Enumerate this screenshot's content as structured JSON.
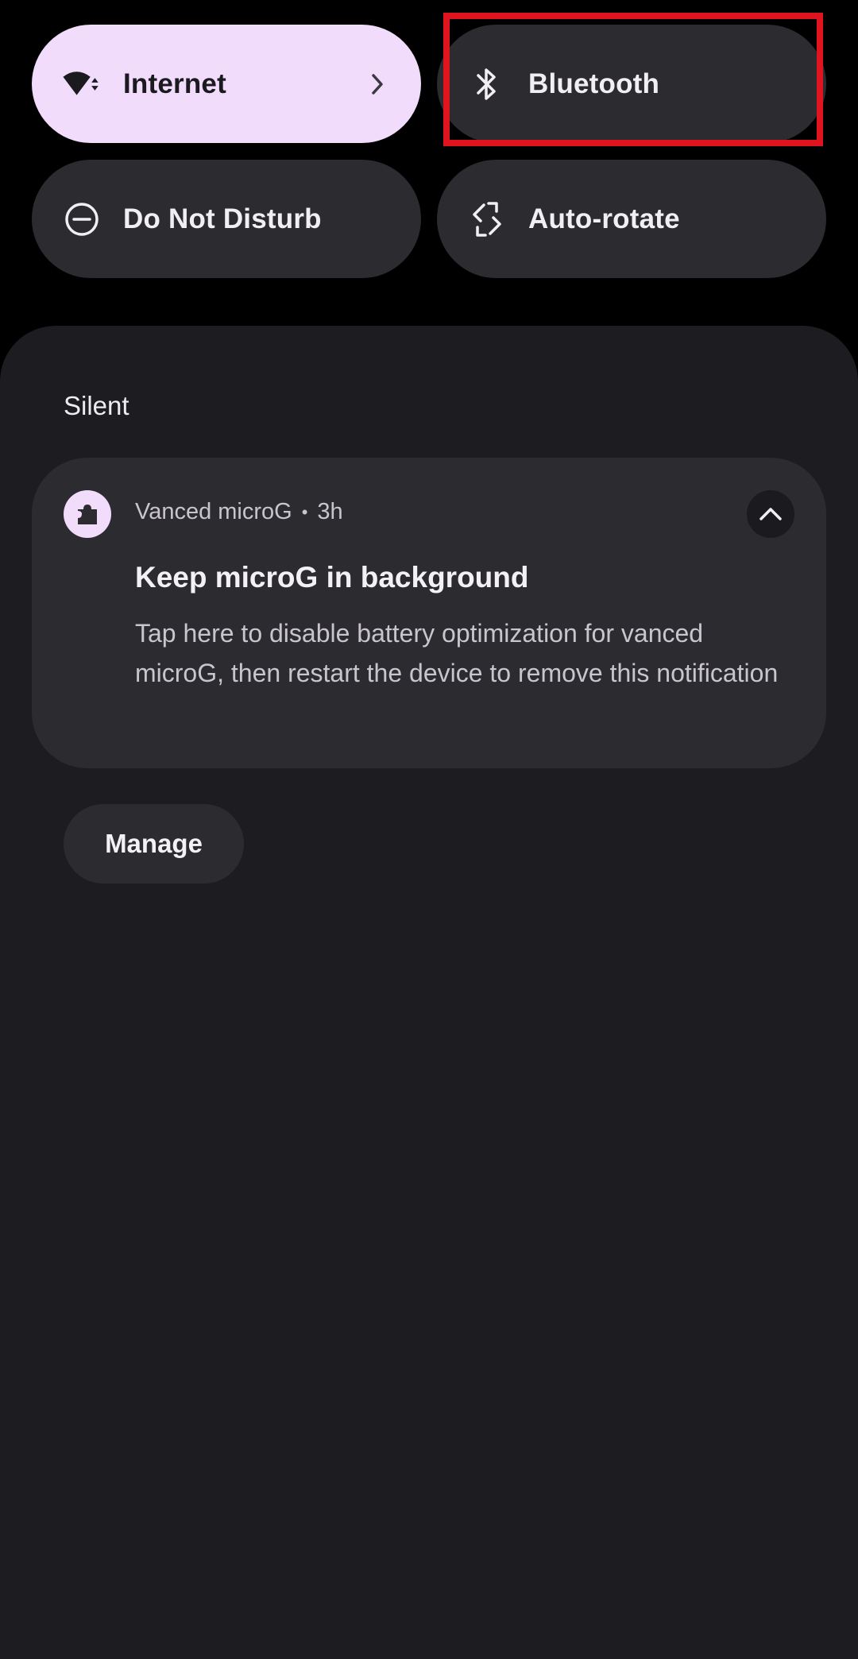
{
  "quick_settings": {
    "tiles": [
      {
        "label": "Internet",
        "icon": "wifi-icon",
        "state": "active"
      },
      {
        "label": "Bluetooth",
        "icon": "bluetooth-icon",
        "state": "inactive"
      },
      {
        "label": "Do Not Disturb",
        "icon": "do-not-disturb-icon",
        "state": "inactive"
      },
      {
        "label": "Auto-rotate",
        "icon": "auto-rotate-icon",
        "state": "inactive"
      }
    ]
  },
  "notifications": {
    "section_title": "Silent",
    "items": [
      {
        "app_name": "Vanced microG",
        "separator": "•",
        "time": "3h",
        "title": "Keep microG in background",
        "body": "Tap here to disable battery optimization for vanced microG, then restart the device to remove this notification",
        "app_icon": "puzzle-icon"
      }
    ],
    "manage_label": "Manage"
  },
  "colors": {
    "active_tile": "#f2dcfc",
    "inactive_tile": "#2c2b30",
    "shade_background": "#1d1c20",
    "highlight": "#e0141e"
  }
}
